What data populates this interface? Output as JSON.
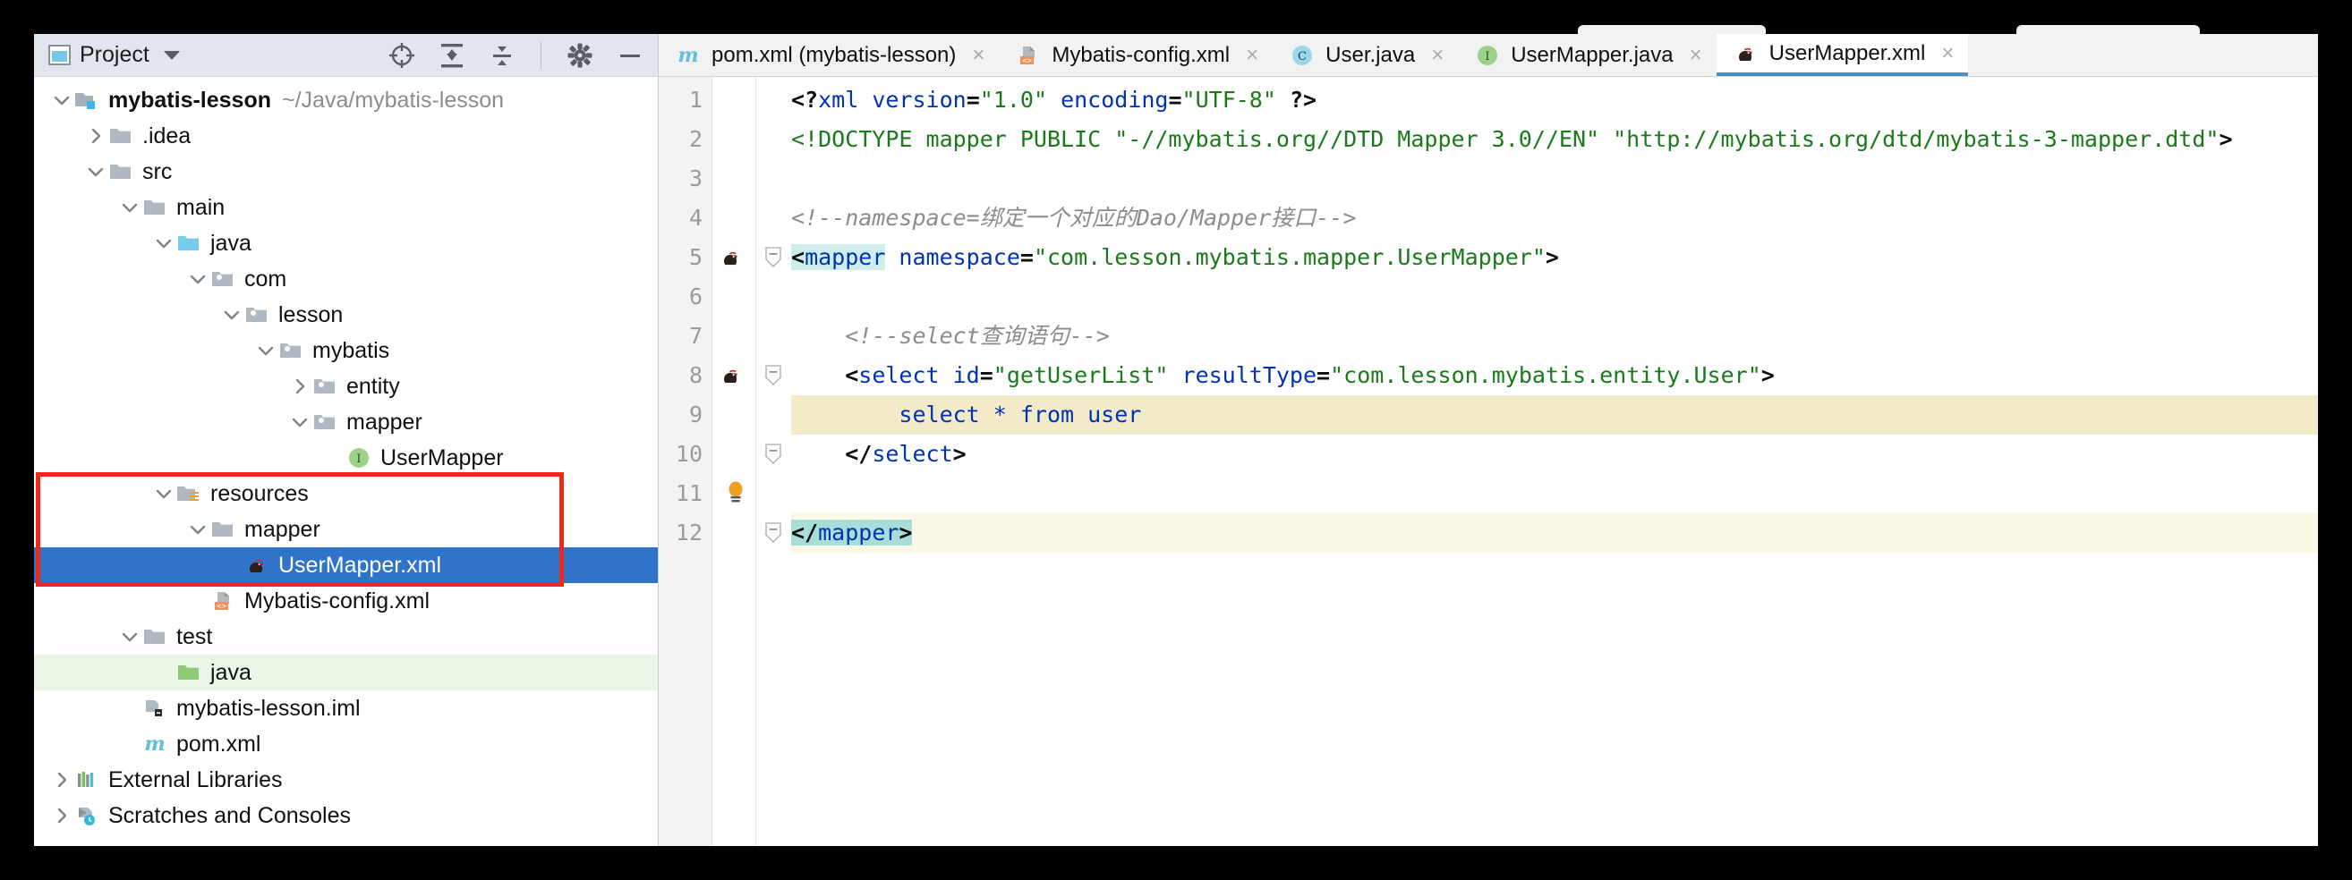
{
  "window": {
    "background": "#000000"
  },
  "sidebar": {
    "header": {
      "title": "Project",
      "icons": [
        "locate-icon",
        "expand-all-icon",
        "collapse-all-icon",
        "gear-icon",
        "minimize-icon"
      ]
    },
    "items": [
      {
        "label": "mybatis-lesson",
        "sublabel": "~/Java/mybatis-lesson",
        "icon": "module-folder-icon",
        "twisty": "expanded",
        "depth": 0,
        "bold": true,
        "state": "normal"
      },
      {
        "label": ".idea",
        "sublabel": "",
        "icon": "folder-icon",
        "twisty": "collapsed",
        "depth": 1,
        "bold": false,
        "state": "normal"
      },
      {
        "label": "src",
        "sublabel": "",
        "icon": "folder-icon",
        "twisty": "expanded",
        "depth": 1,
        "bold": false,
        "state": "normal"
      },
      {
        "label": "main",
        "sublabel": "",
        "icon": "folder-icon",
        "twisty": "expanded",
        "depth": 2,
        "bold": false,
        "state": "normal"
      },
      {
        "label": "java",
        "sublabel": "",
        "icon": "source-folder-icon",
        "twisty": "expanded",
        "depth": 3,
        "bold": false,
        "state": "normal"
      },
      {
        "label": "com",
        "sublabel": "",
        "icon": "package-folder-icon",
        "twisty": "expanded",
        "depth": 4,
        "bold": false,
        "state": "normal"
      },
      {
        "label": "lesson",
        "sublabel": "",
        "icon": "package-folder-icon",
        "twisty": "expanded",
        "depth": 5,
        "bold": false,
        "state": "normal"
      },
      {
        "label": "mybatis",
        "sublabel": "",
        "icon": "package-folder-icon",
        "twisty": "expanded",
        "depth": 6,
        "bold": false,
        "state": "normal"
      },
      {
        "label": "entity",
        "sublabel": "",
        "icon": "package-folder-icon",
        "twisty": "collapsed",
        "depth": 7,
        "bold": false,
        "state": "normal"
      },
      {
        "label": "mapper",
        "sublabel": "",
        "icon": "package-folder-icon",
        "twisty": "expanded",
        "depth": 7,
        "bold": false,
        "state": "normal"
      },
      {
        "label": "UserMapper",
        "sublabel": "",
        "icon": "interface-icon",
        "twisty": "none",
        "depth": 8,
        "bold": false,
        "state": "normal"
      },
      {
        "label": "resources",
        "sublabel": "",
        "icon": "resources-folder-icon",
        "twisty": "expanded",
        "depth": 3,
        "bold": false,
        "state": "normal"
      },
      {
        "label": "mapper",
        "sublabel": "",
        "icon": "folder-icon",
        "twisty": "expanded",
        "depth": 4,
        "bold": false,
        "state": "normal"
      },
      {
        "label": "UserMapper.xml",
        "sublabel": "",
        "icon": "mybatis-bird-icon",
        "twisty": "none",
        "depth": 5,
        "bold": false,
        "state": "selected"
      },
      {
        "label": "Mybatis-config.xml",
        "sublabel": "",
        "icon": "xml-config-icon",
        "twisty": "none",
        "depth": 4,
        "bold": false,
        "state": "normal"
      },
      {
        "label": "test",
        "sublabel": "",
        "icon": "folder-icon",
        "twisty": "expanded",
        "depth": 2,
        "bold": false,
        "state": "normal"
      },
      {
        "label": "java",
        "sublabel": "",
        "icon": "test-source-folder-icon",
        "twisty": "none",
        "depth": 3,
        "bold": false,
        "state": "green"
      },
      {
        "label": "mybatis-lesson.iml",
        "sublabel": "",
        "icon": "iml-icon",
        "twisty": "none",
        "depth": 2,
        "bold": false,
        "state": "normal"
      },
      {
        "label": "pom.xml",
        "sublabel": "",
        "icon": "maven-icon",
        "twisty": "none",
        "depth": 2,
        "bold": false,
        "state": "normal"
      },
      {
        "label": "External Libraries",
        "sublabel": "",
        "icon": "libraries-icon",
        "twisty": "collapsed",
        "depth": 0,
        "bold": false,
        "state": "normal"
      },
      {
        "label": "Scratches and Consoles",
        "sublabel": "",
        "icon": "scratches-icon",
        "twisty": "collapsed",
        "depth": 0,
        "bold": false,
        "state": "normal"
      }
    ],
    "annotation": {
      "color": "#ec2a1b",
      "shape": "rectangle"
    }
  },
  "editor": {
    "tabs": [
      {
        "label": "pom.xml (mybatis-lesson)",
        "icon": "maven-icon",
        "active": false,
        "close": "×"
      },
      {
        "label": "Mybatis-config.xml",
        "icon": "xml-config-icon",
        "active": false,
        "close": "×"
      },
      {
        "label": "User.java",
        "icon": "class-icon",
        "active": false,
        "close": "×"
      },
      {
        "label": "UserMapper.java",
        "icon": "interface-icon",
        "active": false,
        "close": "×"
      },
      {
        "label": "UserMapper.xml",
        "icon": "mybatis-bird-icon",
        "active": true,
        "close": "×"
      }
    ],
    "line_numbers": [
      "1",
      "2",
      "3",
      "4",
      "5",
      "6",
      "7",
      "8",
      "9",
      "10",
      "11",
      "12"
    ],
    "lines": [
      {
        "n": "1",
        "highlight": "none",
        "gutter_icon": "",
        "fold": "",
        "text": "<?xml version=\"1.0\" encoding=\"UTF-8\" ?>"
      },
      {
        "n": "2",
        "highlight": "none",
        "gutter_icon": "",
        "fold": "",
        "text": "<!DOCTYPE mapper PUBLIC \"-//mybatis.org//DTD Mapper 3.0//EN\" \"http://mybatis.org/dtd/mybatis-3-mapper.dtd\">"
      },
      {
        "n": "3",
        "highlight": "none",
        "gutter_icon": "",
        "fold": "",
        "text": ""
      },
      {
        "n": "4",
        "highlight": "none",
        "gutter_icon": "",
        "fold": "",
        "text": "<!--namespace=绑定一个对应的Dao/Mapper接口-->"
      },
      {
        "n": "5",
        "highlight": "none",
        "gutter_icon": "mybatis-bird-icon",
        "fold": "minus",
        "text": "<mapper namespace=\"com.lesson.mybatis.mapper.UserMapper\">"
      },
      {
        "n": "6",
        "highlight": "none",
        "gutter_icon": "",
        "fold": "",
        "text": ""
      },
      {
        "n": "7",
        "highlight": "none",
        "gutter_icon": "",
        "fold": "",
        "text": "    <!--select查询语句-->"
      },
      {
        "n": "8",
        "highlight": "yellow-partial",
        "gutter_icon": "mybatis-bird-icon",
        "fold": "minus",
        "text": "    <select id=\"getUserList\" resultType=\"com.lesson.mybatis.entity.User\">"
      },
      {
        "n": "9",
        "highlight": "yellow",
        "gutter_icon": "",
        "fold": "",
        "text": "        select * from user"
      },
      {
        "n": "10",
        "highlight": "yellow-partial2",
        "gutter_icon": "",
        "fold": "minus",
        "text": "    </select>"
      },
      {
        "n": "11",
        "highlight": "none",
        "gutter_icon": "bulb-icon",
        "fold": "",
        "text": ""
      },
      {
        "n": "12",
        "highlight": "cream",
        "gutter_icon": "",
        "fold": "minus",
        "text": "</mapper>"
      }
    ],
    "code_tokens": {
      "line1": [
        {
          "t": "<?",
          "c": "punct"
        },
        {
          "t": "xml",
          "c": "tag"
        },
        {
          "t": " version",
          "c": "attr"
        },
        {
          "t": "=",
          "c": "punct"
        },
        {
          "t": "\"1.0\"",
          "c": "val"
        },
        {
          "t": " encoding",
          "c": "attr"
        },
        {
          "t": "=",
          "c": "punct"
        },
        {
          "t": "\"UTF-8\"",
          "c": "val"
        },
        {
          "t": " ?>",
          "c": "punct"
        }
      ],
      "line2": [
        {
          "t": "<!DOCTYPE mapper PUBLIC \"-//mybatis.org//DTD Mapper 3.0//EN\" \"http://mybatis.org/dtd/mybatis-3-mapper.dtd\"",
          "c": "doctype"
        },
        {
          "t": ">",
          "c": "punct"
        }
      ],
      "line4": [
        {
          "t": "<!--namespace=绑定一个对应的Dao/Mapper接口-->",
          "c": "comment"
        }
      ],
      "line5": [
        {
          "t": "<",
          "c": "punct"
        },
        {
          "t": "mapper",
          "c": "tag-sel"
        },
        {
          "t": " namespace",
          "c": "attr"
        },
        {
          "t": "=",
          "c": "punct"
        },
        {
          "t": "\"com.lesson.mybatis.mapper.UserMapper\"",
          "c": "val"
        },
        {
          "t": ">",
          "c": "punct"
        }
      ],
      "line7": [
        {
          "t": "    <!--select查询语句-->",
          "c": "comment"
        }
      ],
      "line8": [
        {
          "t": "    <",
          "c": "punct"
        },
        {
          "t": "select",
          "c": "tag"
        },
        {
          "t": " id",
          "c": "attr"
        },
        {
          "t": "=",
          "c": "punct"
        },
        {
          "t": "\"getUserList\"",
          "c": "val"
        },
        {
          "t": " resultType",
          "c": "attr"
        },
        {
          "t": "=",
          "c": "punct"
        },
        {
          "t": "\"com.lesson.mybatis.entity.User\"",
          "c": "val"
        },
        {
          "t": ">",
          "c": "punct"
        }
      ],
      "line9": [
        {
          "t": "        select * from user",
          "c": "tag"
        }
      ],
      "line10": [
        {
          "t": "    </",
          "c": "punct"
        },
        {
          "t": "select",
          "c": "tag"
        },
        {
          "t": ">",
          "c": "punct"
        }
      ],
      "line12": [
        {
          "t": "</",
          "c": "punct"
        },
        {
          "t": "mapper",
          "c": "tag"
        },
        {
          "t": ">",
          "c": "punct"
        }
      ]
    }
  },
  "colors": {
    "selection_blue": "#2f74c8",
    "annotation_red": "#ec2a1b",
    "tab_active_underline": "#4a90c4",
    "highlight_yellow": "#f3eac8",
    "highlight_cream": "#fbf8e8",
    "xml_tag_blue": "#0033b3",
    "xml_value_green": "#1a7a1a",
    "comment_gray": "#8c8c8c",
    "panel_header": "#e1e5ee"
  }
}
